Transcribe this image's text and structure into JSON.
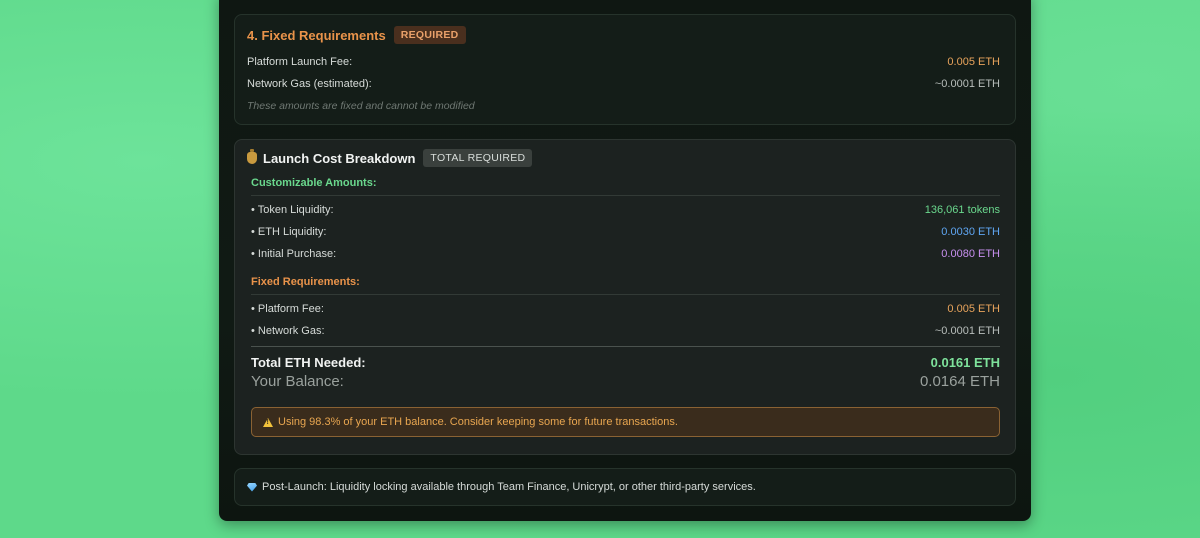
{
  "fixed_requirements": {
    "title": "4. Fixed Requirements",
    "badge": "REQUIRED",
    "rows": [
      {
        "label": "Platform Launch Fee:",
        "value": "0.005 ETH"
      },
      {
        "label": "Network Gas (estimated):",
        "value": "~0.0001 ETH"
      }
    ],
    "note": "These amounts are fixed and cannot be modified"
  },
  "cost_breakdown": {
    "icon": "money-bag-icon",
    "title": "Launch Cost Breakdown",
    "badge": "TOTAL REQUIRED",
    "customizable_heading": "Customizable Amounts:",
    "customizable_rows": [
      {
        "label": "• Token Liquidity:",
        "value": "136,061 tokens"
      },
      {
        "label": "• ETH Liquidity:",
        "value": "0.0030 ETH"
      },
      {
        "label": "• Initial Purchase:",
        "value": "0.0080 ETH"
      }
    ],
    "fixed_heading": "Fixed Requirements:",
    "fixed_rows": [
      {
        "label": "• Platform Fee:",
        "value": "0.005 ETH"
      },
      {
        "label": "• Network Gas:",
        "value": "~0.0001 ETH"
      }
    ],
    "total_label": "Total ETH Needed:",
    "total_value": "0.0161 ETH",
    "balance_label": "Your Balance:",
    "balance_value": "0.0164 ETH",
    "warning_icon": "warning-icon",
    "warning_text": "Using 98.3% of your ETH balance. Consider keeping some for future transactions."
  },
  "post_launch": {
    "icon": "gem-icon",
    "text": "Post-Launch: Liquidity locking available through Team Finance, Unicrypt, or other third-party services."
  },
  "colors": {
    "background": "#5ed98a",
    "panel": "#0f1712",
    "accent_orange": "#e9934a",
    "accent_green": "#6ad88d",
    "accent_blue": "#5fa6f2",
    "accent_purple": "#c890f0"
  }
}
